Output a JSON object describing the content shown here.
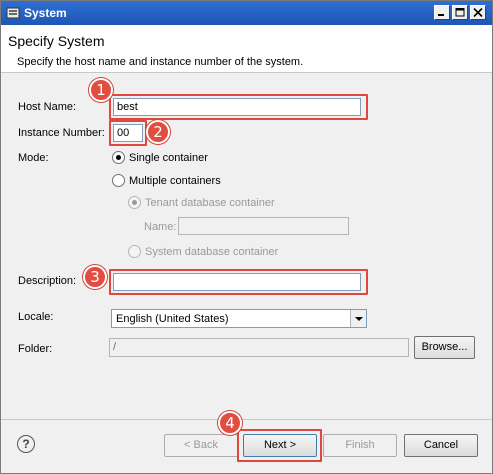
{
  "window": {
    "title": "System",
    "icon": "window-app-icon"
  },
  "header": {
    "title": "Specify System",
    "subtitle": "Specify the host name and instance number of the system."
  },
  "form": {
    "host_name_label": "Host Name:",
    "host_name_value": "best",
    "instance_number_label": "Instance Number:",
    "instance_number_value": "00",
    "mode_label": "Mode:",
    "mode_single": "Single container",
    "mode_multiple": "Multiple containers",
    "tenant_db": "Tenant database container",
    "name_label": "Name:",
    "name_value": "",
    "system_db": "System database container",
    "description_label": "Description:",
    "description_value": "",
    "locale_label": "Locale:",
    "locale_value": "English (United States)",
    "folder_label": "Folder:",
    "folder_value": "/",
    "browse_label": "Browse..."
  },
  "annotations": {
    "one": "1",
    "two": "2",
    "three": "3",
    "four": "4"
  },
  "footer": {
    "back_label": "< Back",
    "next_label": "Next >",
    "finish_label": "Finish",
    "cancel_label": "Cancel",
    "help_glyph": "?"
  },
  "colors": {
    "annotation_red": "#e14d3f",
    "titlebar_blue": "#1f57b5"
  }
}
